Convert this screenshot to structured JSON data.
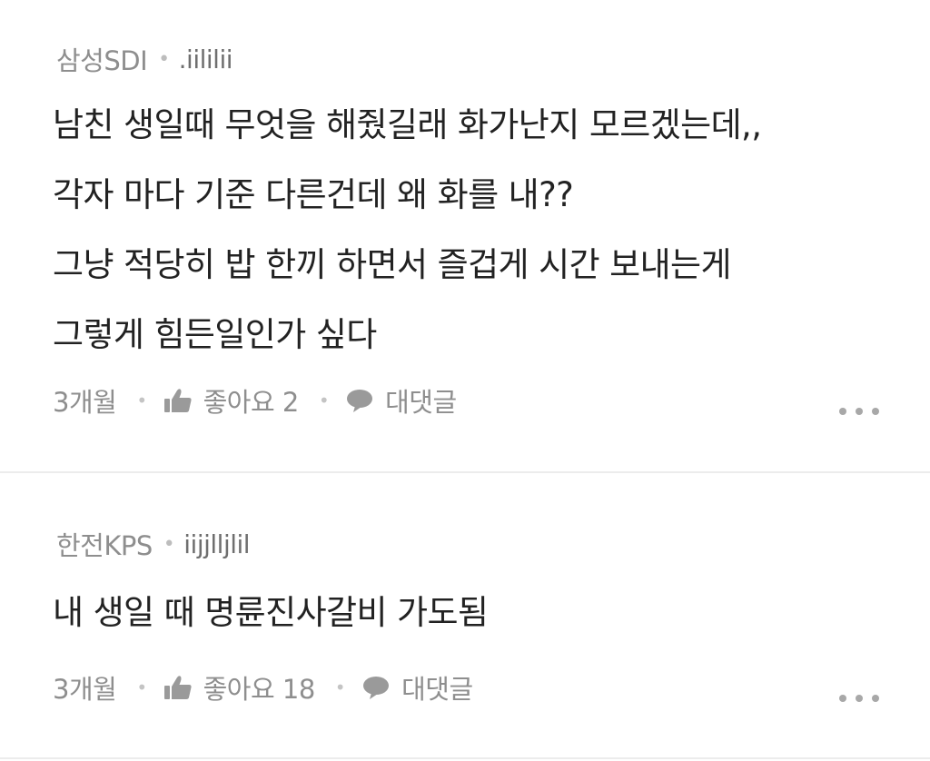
{
  "comments": [
    {
      "company": "삼성SDI",
      "separator": "•",
      "nickname": ".iililii",
      "lines": [
        "남친 생일때 무엇을 해줬길래 화가난지 모르겠는데,,",
        "각자 마다 기준 다른건데 왜 화를 내??",
        "그냥 적당히 밥 한끼 하면서 즐겁게 시간 보내는게",
        "그렇게 힘든일인가 싶다"
      ],
      "time": "3개월",
      "like_label": "좋아요 2",
      "reply_label": "대댓글"
    },
    {
      "company": "한전KPS",
      "separator": "•",
      "nickname": "iijjlljlil",
      "lines": [
        "내 생일 때 명륜진사갈비 가도됨"
      ],
      "time": "3개월",
      "like_label": "좋아요 18",
      "reply_label": "대댓글"
    }
  ],
  "meta_separator": "•",
  "icons": {
    "like": "thumbs-up-icon",
    "reply": "speech-bubble-icon",
    "more": "more-dots-icon"
  },
  "colors": {
    "text_primary": "#222222",
    "text_secondary": "#8e8e8e",
    "divider": "#ececec"
  }
}
